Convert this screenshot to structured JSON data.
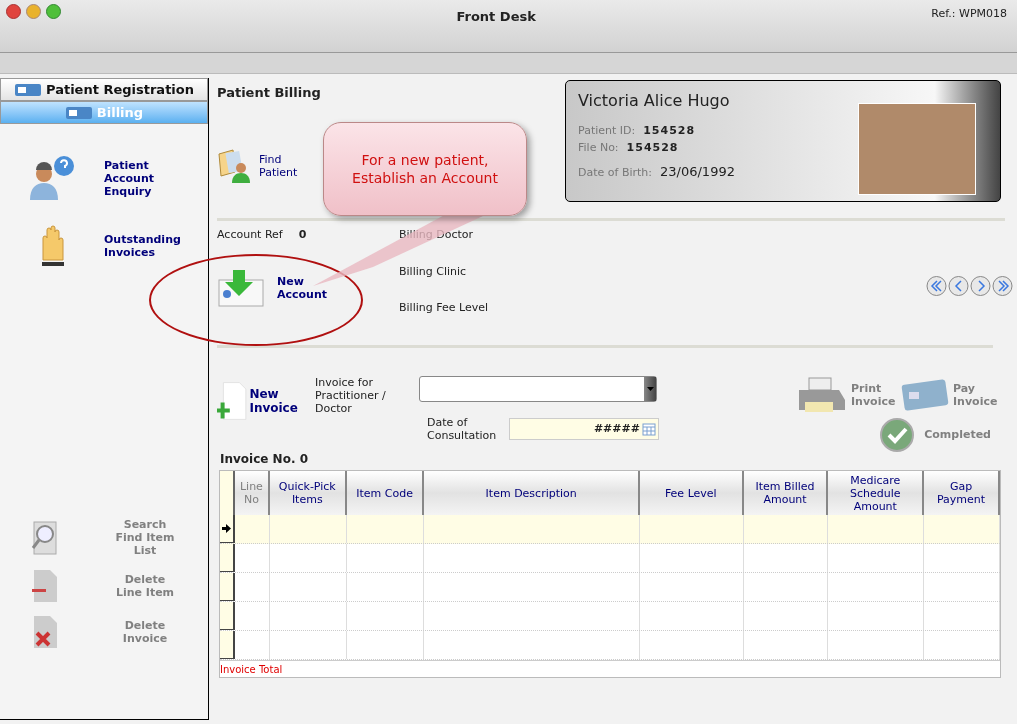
{
  "window": {
    "title": "Front Desk",
    "ref": "Ref.: WPM018"
  },
  "sidebar": {
    "tabs": [
      {
        "label": "Patient Registration",
        "selected": false
      },
      {
        "label": "Billing",
        "selected": true
      }
    ],
    "actions": [
      {
        "label": "Patient Account Enquiry",
        "kind": "enquiry",
        "disabled": false
      },
      {
        "label": "Outstanding Invoices",
        "kind": "hand",
        "disabled": false
      }
    ],
    "tools": [
      {
        "label": "Search Find Item List",
        "kind": "search",
        "disabled": true
      },
      {
        "label": "Delete Line Item",
        "kind": "delete-line",
        "disabled": true
      },
      {
        "label": "Delete Invoice",
        "kind": "delete-invoice",
        "disabled": true
      }
    ]
  },
  "heading": "Patient Billing",
  "find_patient": "Find Patient",
  "callout": "For a new patient, Establish an Account",
  "patient": {
    "name": "Victoria Alice Hugo",
    "fields": [
      {
        "label": "Patient ID:",
        "value": "154528"
      },
      {
        "label": "File No:",
        "value": "154528"
      },
      {
        "label": "Date of Birth:",
        "value": "23/06/1992"
      }
    ]
  },
  "account": {
    "label": "Account Ref",
    "value": "0",
    "new_account": "New Account",
    "billing_fields": [
      "Billing Doctor",
      "Billing Clinic",
      "Billing Fee Level"
    ]
  },
  "invoice": {
    "new_invoice": "New Invoice",
    "practitioner_label": "Invoice for Practitioner / Doctor",
    "date_label": "Date of Consultation",
    "date_value": "#####",
    "number": "Invoice No. 0",
    "actions": [
      {
        "label": "Print Invoice",
        "kind": "print",
        "disabled": true
      },
      {
        "label": "Pay Invoice",
        "kind": "pay",
        "disabled": true
      }
    ],
    "completed": "Completed"
  },
  "table": {
    "columns": [
      {
        "label": "Line No",
        "disabled": true
      },
      {
        "label": "Quick-Pick Items",
        "disabled": false
      },
      {
        "label": "Item Code",
        "disabled": false
      },
      {
        "label": "Item Description",
        "disabled": false
      },
      {
        "label": "Fee Level",
        "disabled": false
      },
      {
        "label": "Item Billed Amount",
        "disabled": false
      },
      {
        "label": "Medicare Schedule Amount",
        "disabled": false
      },
      {
        "label": "Gap Payment",
        "disabled": false
      }
    ],
    "rows": [
      {
        "selected": true
      },
      {
        "selected": false
      },
      {
        "selected": false
      },
      {
        "selected": false
      },
      {
        "selected": false
      }
    ],
    "total_label": "Invoice Total"
  }
}
